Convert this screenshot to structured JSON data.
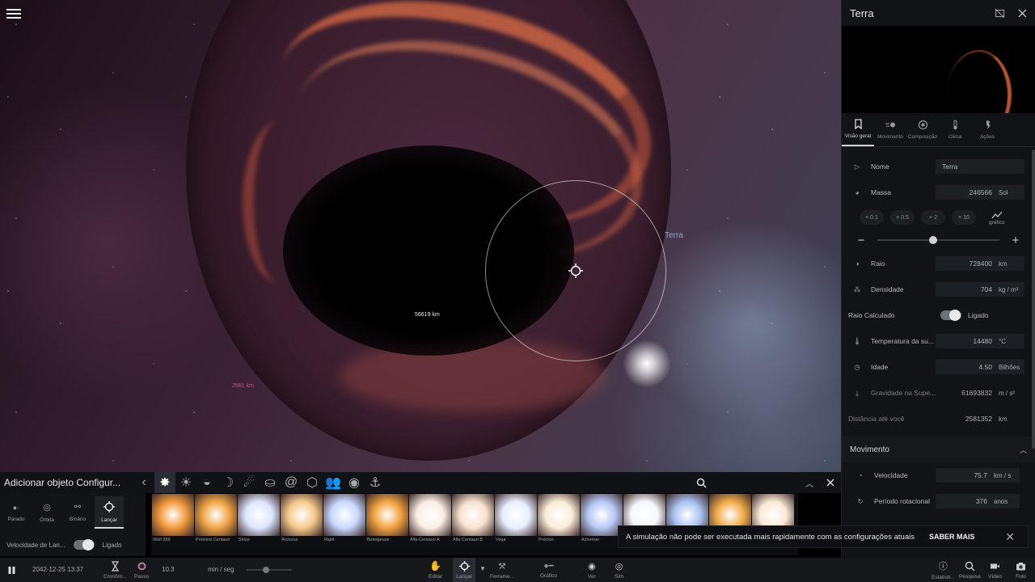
{
  "scene": {
    "distance_label_center": "56619 km",
    "distance_label_left": "2581 km",
    "target_label": "Terra"
  },
  "panel": {
    "title": "Terra",
    "tabs": [
      {
        "label": "Visão geral",
        "icon": "bookmark-icon"
      },
      {
        "label": "Movimento",
        "icon": "motion-icon"
      },
      {
        "label": "Composição",
        "icon": "composition-icon"
      },
      {
        "label": "Clima",
        "icon": "thermometer-icon"
      },
      {
        "label": "Ações",
        "icon": "actions-icon"
      }
    ],
    "props": {
      "name_label": "Nome",
      "name_value": "Terra",
      "mass_label": "Massa",
      "mass_value": "246566",
      "mass_unit": "Sol",
      "mult": [
        "× 0.1",
        "× 0.5",
        "× 2",
        "× 10"
      ],
      "graph_label": "gráfico",
      "radius_label": "Raio",
      "radius_value": "728400",
      "radius_unit": "km",
      "density_label": "Densidade",
      "density_value": "704",
      "density_unit": "kg / m³",
      "calc_radius_label": "Raio Calculado",
      "calc_radius_state": "Ligado",
      "temp_label": "Temperatura da su...",
      "temp_value": "14480",
      "temp_unit": "°C",
      "age_label": "Idade",
      "age_value": "4.50",
      "age_unit": "Bilhões",
      "gravity_label": "Gravidade na Supe...",
      "gravity_value": "61693832",
      "gravity_unit": "m / s²",
      "distance_label": "Distância até você",
      "distance_value": "2581352",
      "distance_unit": "km"
    },
    "movement": {
      "section_title": "Movimento",
      "speed_label": "Velocidade",
      "speed_value": "75.7",
      "speed_unit": "km / s",
      "period_label": "Período rotacional",
      "period_value": "376",
      "period_unit": "anos"
    }
  },
  "add_panel": {
    "title": "Adicionar objeto Configur...",
    "modes": [
      {
        "label": "Parado",
        "icon": "still-icon"
      },
      {
        "label": "Órbita",
        "icon": "orbit-icon"
      },
      {
        "label": "Binário",
        "icon": "binary-icon"
      },
      {
        "label": "Lançar",
        "icon": "launch-icon"
      }
    ],
    "launch_speed_label": "Velocidade de Lan...",
    "launch_speed_state": "Ligado",
    "objects": [
      {
        "label": "Wolf 359",
        "color": "#f29a3c"
      },
      {
        "label": "Próxima Centauri",
        "color": "#f0a545"
      },
      {
        "label": "Sirius",
        "color": "#dce6ff"
      },
      {
        "label": "Arcturus",
        "color": "#f6c98a"
      },
      {
        "label": "Rigel",
        "color": "#c9d8ff"
      },
      {
        "label": "Betelgeuse",
        "color": "#f2a340"
      },
      {
        "label": "Alfa Centauri A",
        "color": "#fbeee4"
      },
      {
        "label": "Alfa Centauri B",
        "color": "#f8e2cf"
      },
      {
        "label": "Vega",
        "color": "#e8eeff"
      },
      {
        "label": "Próclon",
        "color": "#fbecd8"
      },
      {
        "label": "Achernar",
        "color": "#b6c9f4"
      },
      {
        "label": "",
        "color": "#f6f7fb"
      },
      {
        "label": "",
        "color": "#aac2f2"
      },
      {
        "label": "",
        "color": "#f1ad4a"
      },
      {
        "label": "",
        "color": "#fbe9d6"
      }
    ]
  },
  "bottom": {
    "date": "2042-12-25 13:37",
    "chrono_label": "Cronôm...",
    "step_label": "Passo",
    "step_value": "10.3",
    "rate_unit": "min / seg",
    "edit_label": "Editar",
    "launch_label": "Lançar",
    "tools_label": "Ferrame...",
    "graph_label": "Gráfico",
    "view_label": "Ver",
    "sim_label": "Sim",
    "stats_label": "Estatísti...",
    "search_label": "Pesquisa",
    "video_label": "Vídeo",
    "photo_label": "Foto"
  },
  "toast": {
    "message": "A simulação não pode ser executada mais rapidamente com as configurações atuais",
    "action": "SABER MAIS"
  }
}
